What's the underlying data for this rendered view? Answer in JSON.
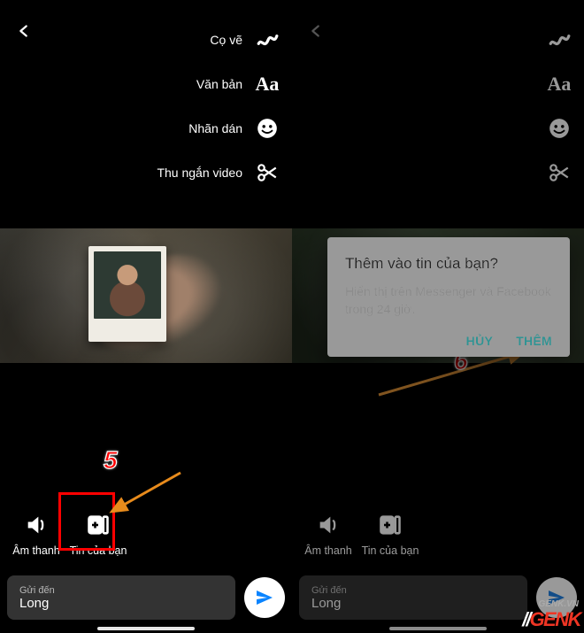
{
  "tools": {
    "brush": {
      "label": "Cọ vẽ",
      "icon": "brush"
    },
    "text": {
      "label": "Văn bản",
      "icon": "text-aa"
    },
    "sticker": {
      "label": "Nhãn dán",
      "icon": "smile"
    },
    "trim": {
      "label": "Thu ngắn video",
      "icon": "scissors"
    }
  },
  "actions": {
    "sound": {
      "label": "Âm thanh",
      "icon": "speaker"
    },
    "story": {
      "label": "Tin của bạn",
      "icon": "add-story"
    }
  },
  "sendbar": {
    "to_label": "Gửi đến",
    "recipient": "Long"
  },
  "dialog": {
    "title": "Thêm vào tin của bạn?",
    "body": "Hiển thị trên Messenger và Facebook trong 24 giờ.",
    "cancel": "HỦY",
    "confirm": "THÊM"
  },
  "steps": {
    "five": "5",
    "six": "6"
  },
  "watermark": {
    "slash": "//",
    "brand": "GENK",
    "tld": "GENK.VN"
  }
}
